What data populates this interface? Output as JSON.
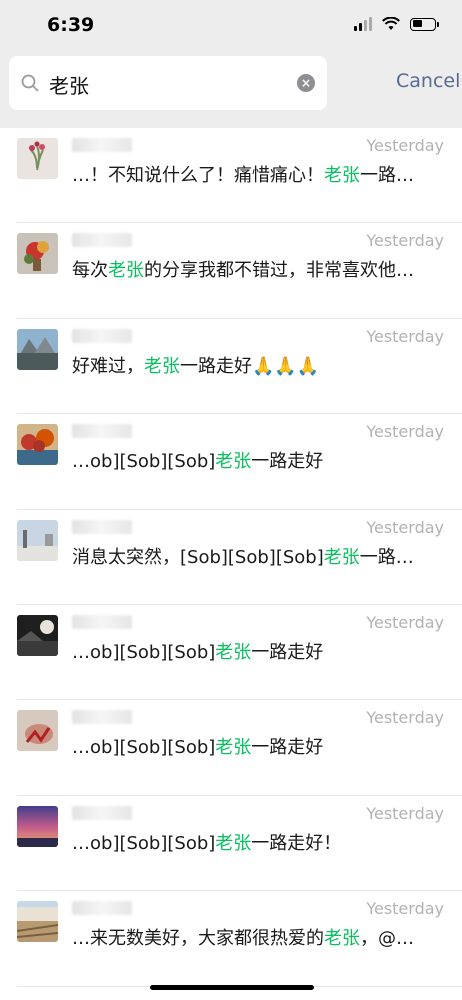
{
  "status": {
    "time": "6:39",
    "battery_level": 0.4
  },
  "search": {
    "query": "老张",
    "cancel_label": "Cancel"
  },
  "results": [
    {
      "time": "Yesterday",
      "pre": "…！不知说什么了！痛惜痛心！",
      "hl": "老张",
      "post": "一路…"
    },
    {
      "time": "Yesterday",
      "pre": "每次",
      "hl": "老张",
      "post": "的分享我都不错过，非常喜欢他…"
    },
    {
      "time": "Yesterday",
      "pre": "好难过，",
      "hl": "老张",
      "post": "一路走好🙏🙏🙏"
    },
    {
      "time": "Yesterday",
      "pre": "…ob][Sob][Sob]",
      "hl": "老张",
      "post": "一路走好"
    },
    {
      "time": "Yesterday",
      "pre": "消息太突然，[Sob][Sob][Sob]",
      "hl": "老张",
      "post": "一路…"
    },
    {
      "time": "Yesterday",
      "pre": "…ob][Sob][Sob]",
      "hl": "老张",
      "post": "一路走好"
    },
    {
      "time": "Yesterday",
      "pre": "…ob][Sob][Sob]",
      "hl": "老张",
      "post": "一路走好"
    },
    {
      "time": "Yesterday",
      "pre": "…ob][Sob][Sob]",
      "hl": "老张",
      "post": "一路走好！"
    },
    {
      "time": "Yesterday",
      "pre": "…来无数美好，大家都很热爱的",
      "hl": "老张",
      "post": "，@…"
    }
  ],
  "colors": {
    "highlight": "#07c160",
    "link": "#576b95",
    "timestamp": "#b2b2b2"
  },
  "icons": {
    "search": "search-icon",
    "clear": "clear-icon"
  }
}
